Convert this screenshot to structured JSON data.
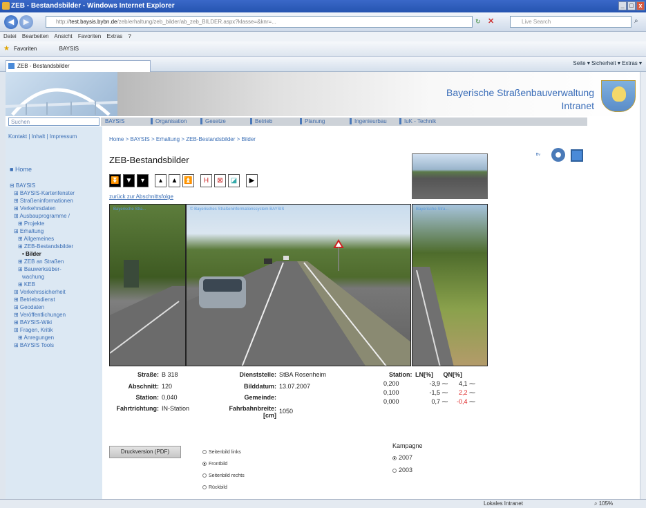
{
  "window": {
    "title": "ZEB - Bestandsbilder - Windows Internet Explorer"
  },
  "browser": {
    "address_host": "test.baysis.bybn.de",
    "address_prefix": "http://",
    "address_path": "/zeb/erhaltung/zeb_bilder/ab_zeb_BILDER.aspx?klasse=&knr=...",
    "search_placeholder": "Live Search",
    "menu": [
      "Datei",
      "Bearbeiten",
      "Ansicht",
      "Favoriten",
      "Extras",
      "?"
    ],
    "favorites_label": "Favoriten",
    "favorites_item": "BAYSIS",
    "tab_title": "ZEB - Bestandsbilder",
    "cmd_bar": "Seite ▾   Sicherheit ▾   Extras ▾",
    "status_zone": "Lokales Intranet",
    "status_zoom": "105%"
  },
  "site": {
    "org_line1": "Bayerische Straßenbauverwaltung",
    "org_line2": "Intranet",
    "search_placeholder": "Suchen",
    "meta_links": "Kontakt | Inhalt | Impressum"
  },
  "topnav": [
    "BAYSIS",
    "Organisation",
    "Gesetze",
    "Betrieb",
    "Planung",
    "Ingenieurbau",
    "IuK - Technik"
  ],
  "sidebar": {
    "home": "Home",
    "items": [
      {
        "label": "BAYSIS",
        "indent": 0
      },
      {
        "label": "BAYSIS-Kartenfenster",
        "indent": 1
      },
      {
        "label": "Straßeninformationen",
        "indent": 1
      },
      {
        "label": "Verkehrsdaten",
        "indent": 1
      },
      {
        "label": "Ausbauprogramme /",
        "indent": 1
      },
      {
        "label": "Projekte",
        "indent": 2
      },
      {
        "label": "Erhaltung",
        "indent": 1
      },
      {
        "label": "Allgemeines",
        "indent": 2
      },
      {
        "label": "ZEB-Bestandsbilder",
        "indent": 2
      },
      {
        "label": "Bilder",
        "indent": 3,
        "bold": true
      },
      {
        "label": "ZEB an Straßen",
        "indent": 2
      },
      {
        "label": "Bauwerksüber-",
        "indent": 2
      },
      {
        "label": "wachung",
        "indent": 3
      },
      {
        "label": "KEB",
        "indent": 2
      },
      {
        "label": "Verkehrssicherheit",
        "indent": 1
      },
      {
        "label": "Betriebsdienst",
        "indent": 1
      },
      {
        "label": "Geodaten",
        "indent": 1
      },
      {
        "label": "Veröffentlichungen",
        "indent": 1
      },
      {
        "label": "BAYSIS-Wiki",
        "indent": 1
      },
      {
        "label": "Fragen, Kritik",
        "indent": 1
      },
      {
        "label": "Anregungen",
        "indent": 2
      },
      {
        "label": "BAYSIS Tools",
        "indent": 1
      }
    ]
  },
  "breadcrumb": "Home > BAYSIS > Erhaltung > ZEB-Bestandsbilder > Bilder",
  "page_title": "ZEB-Bestandsbilder",
  "back_link": "zurück zur Abschnittsfolge",
  "photos": {
    "left_label": "Bayerische Stra...",
    "center_label": "© Bayerisches Straßeninformationssystem BAYSIS",
    "right_label": "Bayerische Stra..."
  },
  "info": {
    "strasse_label": "Straße:",
    "strasse": "B 318",
    "abschnitt_label": "Abschnitt:",
    "abschnitt": "120",
    "station_label": "Station:",
    "station": "0,040",
    "fahrtrichtung_label": "Fahrtrichtung:",
    "fahrtrichtung": "IN-Station",
    "dienststelle_label": "Dienststelle:",
    "dienststelle": "StBA Rosenheim",
    "bilddatum_label": "Bilddatum:",
    "bilddatum": "13.07.2007",
    "gemeinde_label": "Gemeinde:",
    "gemeinde": "",
    "fahrbahnbreite_label": "Fahrbahnbreite:",
    "fahrbahnbreite_unit": "[cm]",
    "fahrbahnbreite": "1050"
  },
  "station_table": {
    "headers": [
      "Station:",
      "LN[%]",
      "QN[%]"
    ],
    "rows": [
      {
        "station": "0,200",
        "ln": "-3,9",
        "qn": "4,1",
        "qn_red": false
      },
      {
        "station": "0,100",
        "ln": "-1,5",
        "qn": "2,2",
        "qn_red": true
      },
      {
        "station": "0,000",
        "ln": "0,7",
        "qn": "-0,4",
        "qn_red": true
      }
    ]
  },
  "pdf_button": "Druckversion (PDF)",
  "view_options": [
    {
      "label": "Seitenbild links",
      "checked": false
    },
    {
      "label": "Frontbild",
      "checked": true
    },
    {
      "label": "Seitenbild rechts",
      "checked": false
    },
    {
      "label": "Rückbild",
      "checked": false
    }
  ],
  "kampagne": {
    "label": "Kampagne",
    "options": [
      {
        "label": "2007",
        "checked": true
      },
      {
        "label": "2003",
        "checked": false
      }
    ]
  },
  "colors": {
    "link": "#3a6eb5",
    "title_bar": "#2554b0",
    "sidebar_bg": "#dce8f3",
    "red": "#dd2222"
  }
}
